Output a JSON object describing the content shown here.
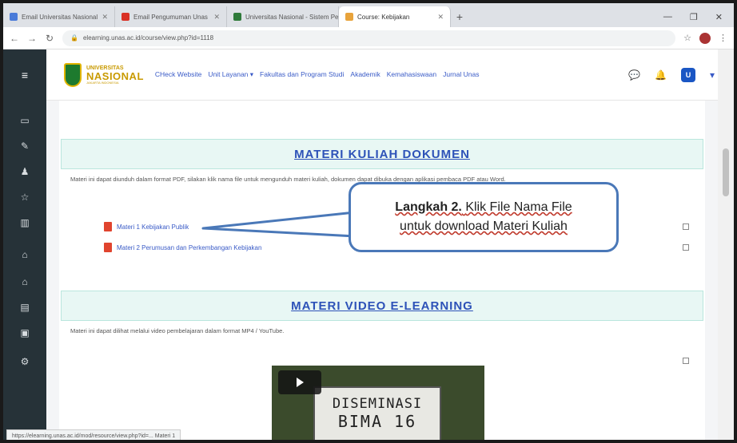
{
  "browser": {
    "tabs": [
      {
        "label": "Email Universitas Nasional",
        "color": "#4a7bd9"
      },
      {
        "label": "Email Pengumuman Unas",
        "color": "#d93025"
      },
      {
        "label": "Universitas Nasional - Sistem Pe...",
        "color": "#2f7a3a"
      },
      {
        "label": "Course: Kebijakan",
        "color": "#e8a33b"
      }
    ],
    "url": "elearning.unas.ac.id/course/view.php?id=1118"
  },
  "header": {
    "logo_line1": "UNIVERSITAS",
    "logo_line2": "NASIONAL",
    "logo_line3": "JAKARTA INDONESIA",
    "menu": [
      "CHeck Website",
      "Unit Layanan ▾",
      "Fakultas dan Program Studi",
      "Akademik",
      "Kemahasiswaan",
      "Jurnal Unas"
    ],
    "avatar_letter": "U"
  },
  "sections": {
    "dokumen": {
      "title": "MATERI KULIAH DOKUMEN",
      "desc": "Materi ini dapat diunduh dalam format PDF, silakan klik nama file untuk mengunduh materi kuliah, dokumen dapat dibuka dengan aplikasi pembaca PDF atau Word.",
      "files": [
        "Materi 1 Kebijakan Publik",
        "Materi 2 Perumusan dan Perkembangan Kebijakan"
      ]
    },
    "video": {
      "title": "MATERI VIDEO E-LEARNING",
      "desc": "Materi ini dapat dilihat melalui video pembelajaran dalam format MP4 / YouTube.",
      "sign_line1": "DISEMINASI",
      "sign_line2": "BIMA 16"
    }
  },
  "callout": {
    "part1_bold": "Langkah 2.",
    "part1_rest": "Klik File Nama File",
    "line2": "untuk download Materi Kuliah"
  },
  "status_bar": "https://elearning.unas.ac.id/mod/resource/view.php?id=... Materi 1"
}
